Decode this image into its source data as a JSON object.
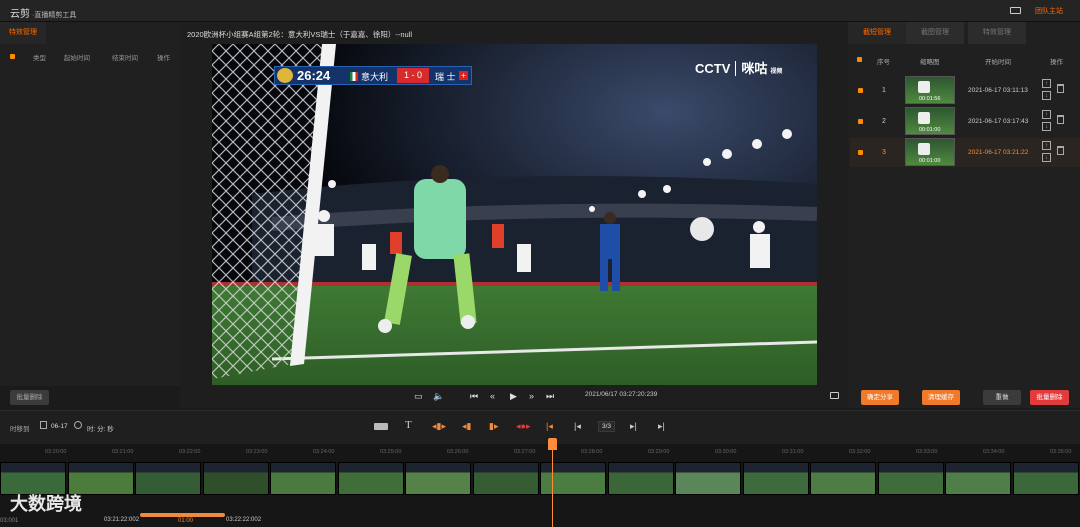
{
  "app": {
    "title": "云剪",
    "subtitle": "·直播精剪工具",
    "top_link": "团队主站"
  },
  "left_panel": {
    "tab": "特效管理",
    "columns": [
      "类型",
      "起始时间",
      "结束时间",
      "操作"
    ],
    "batch_delete": "批量删除"
  },
  "center": {
    "match_title": "2020欧洲杯小组赛A组第2轮：意大利VS瑞士（于嘉嘉、徐阳）--null",
    "scorebug": {
      "clock": "26:24",
      "team1": "意大利",
      "score": "1 - 0",
      "team2": "瑞 士"
    },
    "broadcaster": "CCTV",
    "broadcaster_sub": "咪咕",
    "broadcaster_sub2": "视频",
    "video_time": "2021/06/17 03:27:20:239"
  },
  "right_panel": {
    "tabs": [
      "截短管理",
      "截图管理",
      "特效管理"
    ],
    "columns": [
      "序号",
      "缩略图",
      "开始时间",
      "操作"
    ],
    "rows": [
      {
        "index": "1",
        "duration": "00:01:56",
        "start": "2021-06-17 03:11:13",
        "active": false
      },
      {
        "index": "2",
        "duration": "00:01:00",
        "start": "2021-06-17 03:17:43",
        "active": false
      },
      {
        "index": "3",
        "duration": "00:01:00",
        "start": "2021-06-17 03:21:22",
        "active": true
      }
    ],
    "buttons": [
      "确定分享",
      "清理缓存",
      "重做",
      "批量删除"
    ]
  },
  "toolbar": {
    "time_label": "时移到",
    "date": "06-17",
    "hms_placeholder": "时: 分: 秒",
    "page": "3/3"
  },
  "timeline": {
    "ruler_times": [
      "03:20:00",
      "03:21:00",
      "03:22:00",
      "03:23:00",
      "03:24:00",
      "03:25:00",
      "03:26:00",
      "03:27:00",
      "03:28:00",
      "03:29:00",
      "03:30:00",
      "03:31:00",
      "03:32:00",
      "03:33:00",
      "03:34:00",
      "03:35:00"
    ],
    "clip_start": "03:21:22:002",
    "clip_len": "01:00",
    "clip_end": "03:22:22:002",
    "left_edge_time": "03:001"
  },
  "watermark": "大数跨境",
  "colors": {
    "accent": "#ff6a00",
    "danger": "#e23b3b",
    "orange_btn": "#f07a2a"
  }
}
